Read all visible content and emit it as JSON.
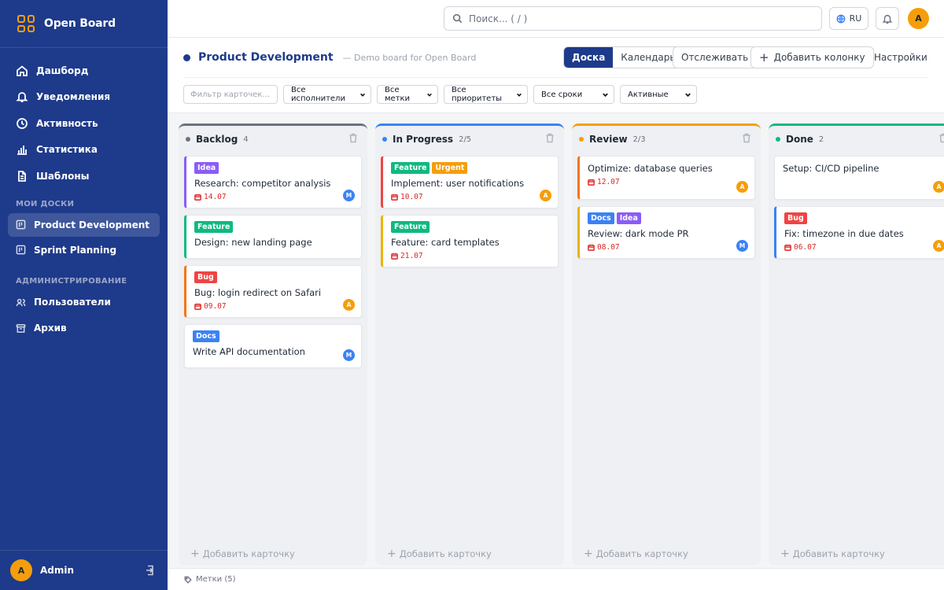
{
  "app": {
    "name": "Open Board",
    "accent": "#1e3a8a",
    "brand_accent": "#f59e0b"
  },
  "sidebar": {
    "nav": [
      {
        "label": "Дашборд",
        "icon": "home-icon"
      },
      {
        "label": "Уведомления",
        "icon": "bell-icon"
      },
      {
        "label": "Активность",
        "icon": "clock-icon"
      },
      {
        "label": "Статистика",
        "icon": "bar-chart-icon"
      },
      {
        "label": "Шаблоны",
        "icon": "document-icon"
      }
    ],
    "boards_section": "МОИ ДОСКИ",
    "boards": [
      {
        "label": "Product Development",
        "active": true
      },
      {
        "label": "Sprint Planning",
        "active": false
      }
    ],
    "admin_section": "АДМИНИСТРИРОВАНИЕ",
    "admin": [
      {
        "label": "Пользователи",
        "icon": "users-icon"
      },
      {
        "label": "Архив",
        "icon": "archive-icon"
      }
    ],
    "user": {
      "initial": "A",
      "name": "Admin"
    }
  },
  "topbar": {
    "search_placeholder": "Поиск... ( / )",
    "lang": "RU",
    "user_initial": "A"
  },
  "board": {
    "title": "Product Development",
    "description": "— Demo board for Open Board",
    "views": {
      "board": "Доска",
      "calendar": "Календарь"
    },
    "track_label": "Отслеживать",
    "add_column_label": "Добавить колонку",
    "settings_label": "Настройки",
    "filters": {
      "card_placeholder": "Фильтр карточек...",
      "assignees": "Все исполнители",
      "labels": "Все метки",
      "priorities": "Все приоритеты",
      "due": "Все сроки",
      "status": "Активные"
    },
    "add_card_label": "Добавить карточку",
    "footer_labels": "Метки (5)"
  },
  "tag_colors": {
    "Idea": "#8b5cf6",
    "Feature": "#10b981",
    "Bug": "#ef4444",
    "Docs": "#3b82f6",
    "Urgent": "#f59e0b"
  },
  "avatar_colors": {
    "M": "#3b82f6",
    "A": "#f59e0b"
  },
  "columns": [
    {
      "name": "Backlog",
      "count": "4",
      "color": "#6b7280",
      "cards": [
        {
          "tags": [
            "Idea"
          ],
          "title": "Research: competitor analysis",
          "date": "14.07",
          "avatar": "M",
          "border": "#8b5cf6"
        },
        {
          "tags": [
            "Feature"
          ],
          "title": "Design: new landing page",
          "date": "",
          "avatar": "",
          "border": "#10b981"
        },
        {
          "tags": [
            "Bug"
          ],
          "title": "Bug: login redirect on Safari",
          "date": "09.07",
          "avatar": "A",
          "border": "#f97316"
        },
        {
          "tags": [
            "Docs"
          ],
          "title": "Write API documentation",
          "date": "",
          "avatar": "M",
          "border": ""
        }
      ]
    },
    {
      "name": "In Progress",
      "count": "2/5",
      "color": "#3b82f6",
      "cards": [
        {
          "tags": [
            "Feature",
            "Urgent"
          ],
          "title": "Implement: user notifications",
          "date": "10.07",
          "avatar": "A",
          "border": "#ef4444"
        },
        {
          "tags": [
            "Feature"
          ],
          "title": "Feature: card templates",
          "date": "21.07",
          "avatar": "",
          "border": "#eab308"
        }
      ]
    },
    {
      "name": "Review",
      "count": "2/3",
      "color": "#f59e0b",
      "cards": [
        {
          "tags": [],
          "title": "Optimize: database queries",
          "date": "12.07",
          "avatar": "A",
          "border": "#f97316"
        },
        {
          "tags": [
            "Docs",
            "Idea"
          ],
          "title": "Review: dark mode PR",
          "date": "08.07",
          "avatar": "M",
          "border": "#eab308"
        }
      ]
    },
    {
      "name": "Done",
      "count": "2",
      "color": "#10b981",
      "cards": [
        {
          "tags": [],
          "title": "Setup: CI/CD pipeline",
          "date": "",
          "avatar": "A",
          "border": ""
        },
        {
          "tags": [
            "Bug"
          ],
          "title": "Fix: timezone in due dates",
          "date": "06.07",
          "avatar": "A",
          "border": "#3b82f6"
        }
      ]
    }
  ]
}
